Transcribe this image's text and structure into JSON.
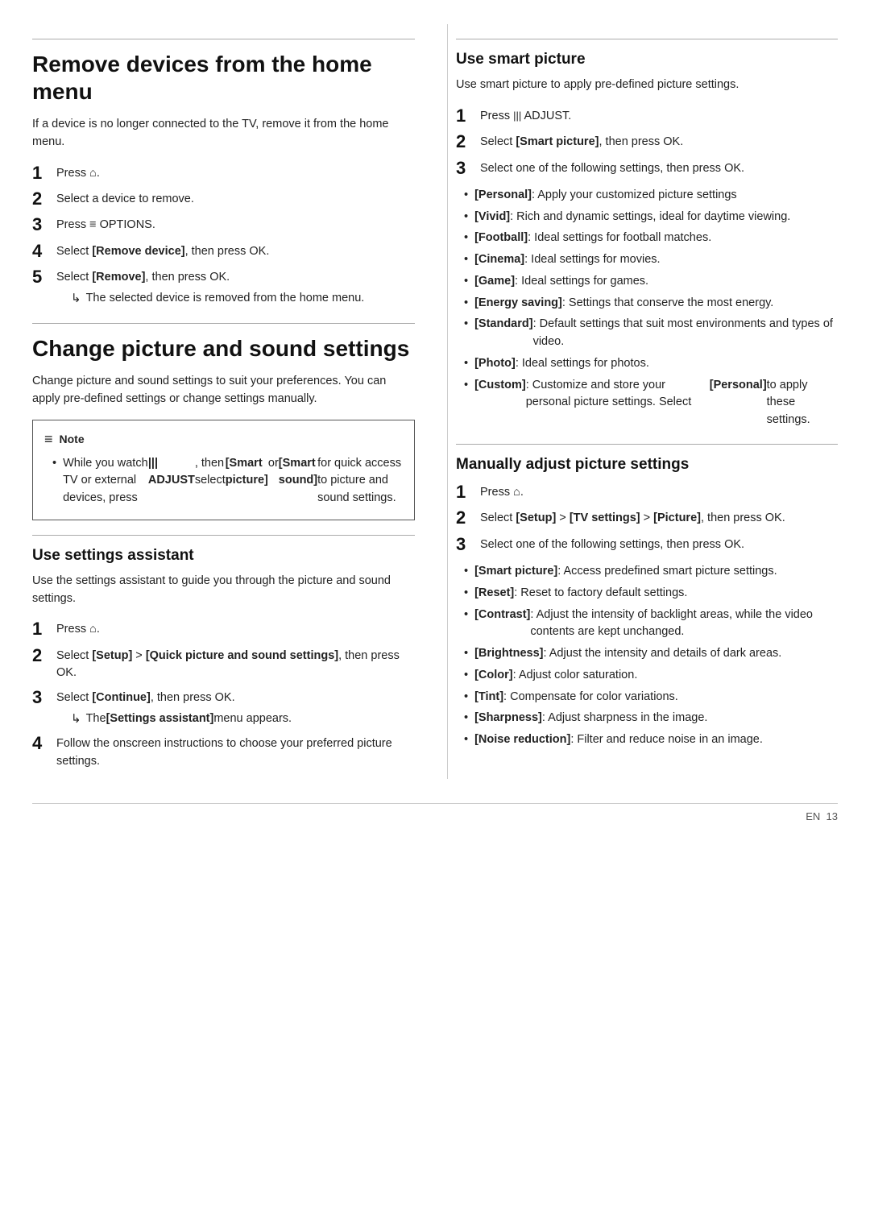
{
  "left": {
    "section1": {
      "title": "Remove devices from the home menu",
      "intro": "If a device is no longer connected to the TV, remove it from the home menu.",
      "steps": [
        {
          "num": "1",
          "text": "Press",
          "icon": "home",
          "after": "."
        },
        {
          "num": "2",
          "text": "Select a device to remove."
        },
        {
          "num": "3",
          "text": "Press",
          "icon": "options",
          "after": " OPTIONS."
        },
        {
          "num": "4",
          "text": "Select [Remove device], then press OK."
        },
        {
          "num": "5",
          "text": "Select [Remove], then press OK.",
          "result": "The selected device is removed from the home menu."
        }
      ]
    },
    "section2": {
      "title": "Change picture and sound settings",
      "intro": "Change picture and sound settings to suit your preferences. You can apply pre-defined settings or change settings manually.",
      "note": {
        "header": "Note",
        "text": "While you watch TV or external devices, press ||| ADJUST, then select [Smart picture] or [Smart sound] for quick access to picture and sound settings."
      }
    },
    "section3": {
      "title": "Use settings assistant",
      "intro": "Use the settings assistant to guide you through the picture and sound settings.",
      "steps": [
        {
          "num": "1",
          "text": "Press",
          "icon": "home",
          "after": "."
        },
        {
          "num": "2",
          "text": "Select [Setup] > [Quick picture and sound settings], then press OK."
        },
        {
          "num": "3",
          "text": "Select [Continue], then press OK.",
          "result": "The [Settings assistant] menu appears."
        },
        {
          "num": "4",
          "text": "Follow the onscreen instructions to choose your preferred picture settings."
        }
      ]
    }
  },
  "right": {
    "section1": {
      "title": "Use smart picture",
      "intro": "Use smart picture to apply pre-defined picture settings.",
      "steps": [
        {
          "num": "1",
          "text": "Press",
          "icon": "adjust",
          "after": " ADJUST."
        },
        {
          "num": "2",
          "text": "Select [Smart picture], then press OK."
        },
        {
          "num": "3",
          "text": "Select one of the following settings, then press OK."
        }
      ],
      "bullets": [
        "[Personal]: Apply your customized picture settings",
        "[Vivid]: Rich and dynamic settings, ideal for daytime viewing.",
        "[Football]: Ideal settings for football matches.",
        "[Cinema]: Ideal settings for movies.",
        "[Game]: Ideal settings for games.",
        "[Energy saving]: Settings that conserve the most energy.",
        "[Standard]: Default settings that suit most environments and types of video.",
        "[Photo]: Ideal settings for photos.",
        "[Custom]: Customize and store your personal picture settings. Select [Personal] to apply these settings."
      ]
    },
    "section2": {
      "title": "Manually adjust picture settings",
      "steps": [
        {
          "num": "1",
          "text": "Press",
          "icon": "home",
          "after": "."
        },
        {
          "num": "2",
          "text": "Select [Setup] > [TV settings] > [Picture], then press OK."
        },
        {
          "num": "3",
          "text": "Select one of the following settings, then press OK."
        }
      ],
      "bullets": [
        "[Smart picture]: Access predefined smart picture settings.",
        "[Reset]: Reset to factory default settings.",
        "[Contrast]: Adjust the intensity of backlight areas, while the video contents are kept unchanged.",
        "[Brightness]: Adjust the intensity and details of dark areas.",
        "[Color]: Adjust color saturation.",
        "[Tint]: Compensate for color variations.",
        "[Sharpness]: Adjust sharpness in the image.",
        "[Noise reduction]: Filter and reduce noise in an image."
      ]
    }
  },
  "footer": {
    "lang": "EN",
    "page": "13"
  }
}
